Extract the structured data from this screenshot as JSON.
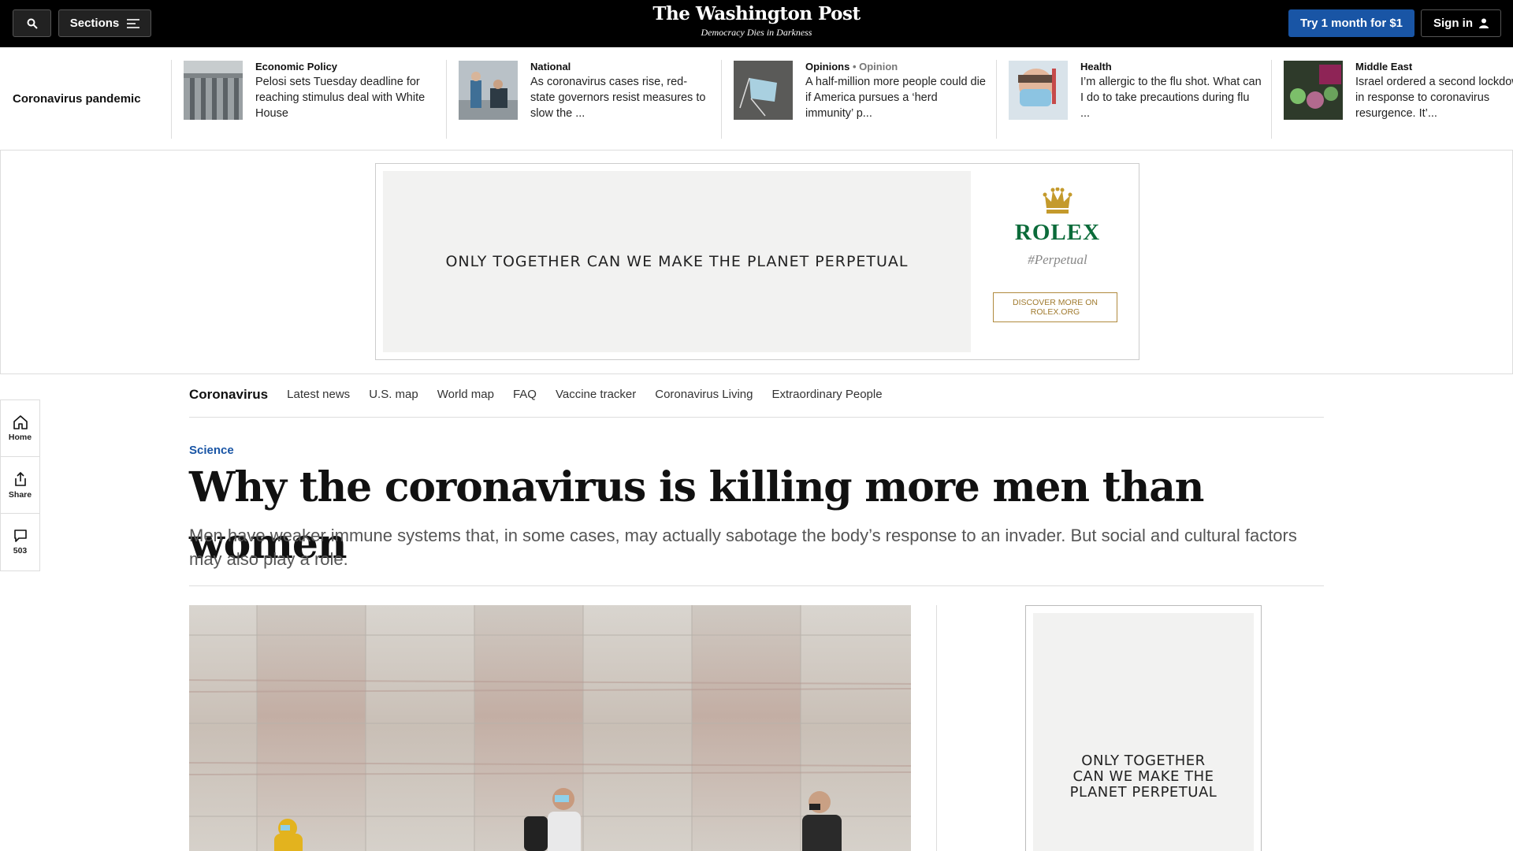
{
  "header": {
    "sections_label": "Sections",
    "logo": "The Washington Post",
    "tagline": "Democracy Dies in Darkness",
    "subscribe_label": "Try 1 month for $1",
    "signin_label": "Sign in"
  },
  "strip": {
    "label": "Coronavirus pandemic",
    "items": [
      {
        "kicker": "Economic Policy",
        "opinion": "",
        "title": "Pelosi sets Tuesday deadline for reaching stimulus deal with White House"
      },
      {
        "kicker": "National",
        "opinion": "",
        "title": "As coronavirus cases rise, red-state governors resist measures to slow the ..."
      },
      {
        "kicker": "Opinions",
        "opinion": "• Opinion",
        "title": "A half-million more people could die if America pursues a ‘herd immunity’ p..."
      },
      {
        "kicker": "Health",
        "opinion": "",
        "title": "I’m allergic to the flu shot. What can I do to take precautions during flu ..."
      },
      {
        "kicker": "Middle East",
        "opinion": "",
        "title": "Israel ordered a second lockdown in response to coronavirus resurgence. It’..."
      }
    ]
  },
  "top_ad": {
    "slogan": "ONLY TOGETHER CAN WE MAKE THE PLANET PERPETUAL",
    "brand": "ROLEX",
    "hashtag": "#Perpetual",
    "cta_line1": "DISCOVER MORE ON",
    "cta_line2": "ROLEX.ORG"
  },
  "rail": {
    "home_label": "Home",
    "share_label": "Share",
    "comments_count": "503"
  },
  "subnav": {
    "title": "Coronavirus",
    "links": [
      "Latest news",
      "U.S. map",
      "World map",
      "FAQ",
      "Vaccine tracker",
      "Coronavirus Living",
      "Extraordinary People"
    ]
  },
  "article": {
    "kicker": "Science",
    "headline": "Why the coronavirus is killing more men than women",
    "dek": "Men have weaker immune systems that, in some cases, may actually sabotage the body’s response to an invader. But social and cultural factors may also play a role."
  },
  "side_ad": {
    "line1": "ONLY TOGETHER",
    "line2": "CAN WE MAKE THE",
    "line3": "PLANET PERPETUAL"
  },
  "colors": {
    "brand_blue": "#1955a5",
    "rolex_green": "#0b6b3a",
    "rolex_gold": "#b08a3e",
    "topbar": "#000000"
  }
}
